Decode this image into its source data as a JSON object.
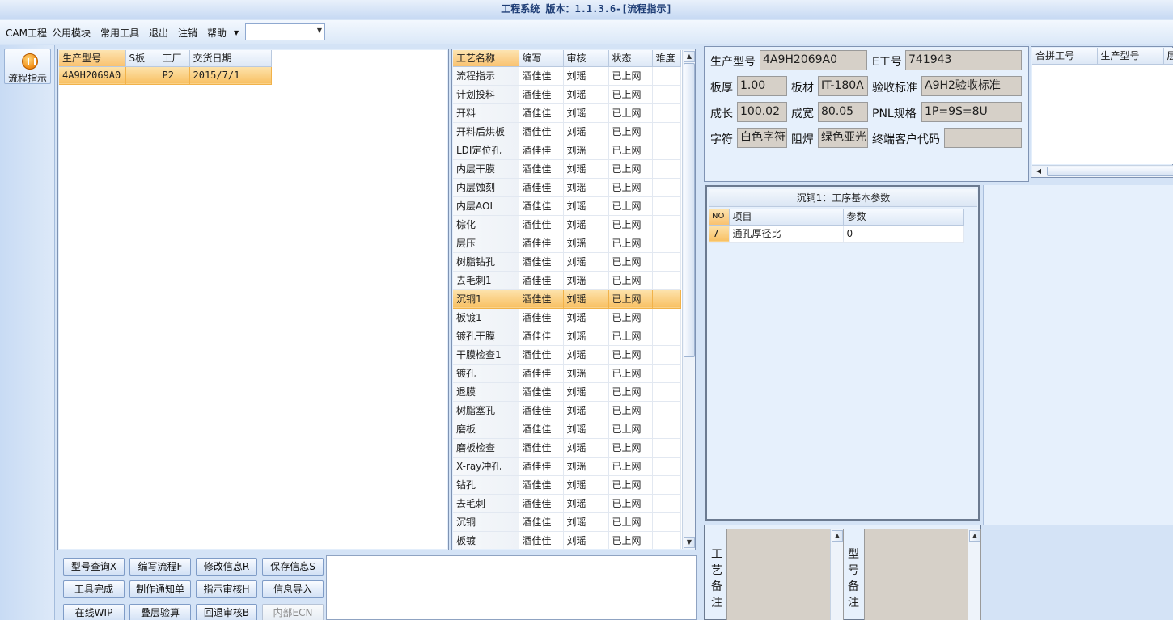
{
  "window": {
    "title": "工程系统 版本：1.1.3.6-[流程指示]"
  },
  "menu": {
    "items": [
      "CAM工程",
      "公用模块",
      "常用工具",
      "退出",
      "注销",
      "帮助"
    ],
    "combo_value": ""
  },
  "nav": {
    "button_label": "流程指示"
  },
  "order_grid": {
    "columns": [
      "生产型号",
      "S板",
      "工厂",
      "交货日期"
    ],
    "rows": [
      [
        "4A9H2069A0",
        "",
        "P2",
        "2015/7/1"
      ]
    ]
  },
  "process_grid": {
    "columns": [
      "工艺名称",
      "编写",
      "审核",
      "状态",
      "难度"
    ],
    "selected_index": 12,
    "rows": [
      [
        "流程指示",
        "酒佳佳",
        "刘瑶",
        "已上网",
        ""
      ],
      [
        "计划投料",
        "酒佳佳",
        "刘瑶",
        "已上网",
        ""
      ],
      [
        "开料",
        "酒佳佳",
        "刘瑶",
        "已上网",
        ""
      ],
      [
        "开料后烘板",
        "酒佳佳",
        "刘瑶",
        "已上网",
        ""
      ],
      [
        "LDI定位孔",
        "酒佳佳",
        "刘瑶",
        "已上网",
        ""
      ],
      [
        "内层干膜",
        "酒佳佳",
        "刘瑶",
        "已上网",
        ""
      ],
      [
        "内层蚀刻",
        "酒佳佳",
        "刘瑶",
        "已上网",
        ""
      ],
      [
        "内层AOI",
        "酒佳佳",
        "刘瑶",
        "已上网",
        ""
      ],
      [
        "棕化",
        "酒佳佳",
        "刘瑶",
        "已上网",
        ""
      ],
      [
        "层压",
        "酒佳佳",
        "刘瑶",
        "已上网",
        ""
      ],
      [
        "树脂钻孔",
        "酒佳佳",
        "刘瑶",
        "已上网",
        ""
      ],
      [
        "去毛刺1",
        "酒佳佳",
        "刘瑶",
        "已上网",
        ""
      ],
      [
        "沉铜1",
        "酒佳佳",
        "刘瑶",
        "已上网",
        ""
      ],
      [
        "板镀1",
        "酒佳佳",
        "刘瑶",
        "已上网",
        ""
      ],
      [
        "镀孔干膜",
        "酒佳佳",
        "刘瑶",
        "已上网",
        ""
      ],
      [
        "干膜检查1",
        "酒佳佳",
        "刘瑶",
        "已上网",
        ""
      ],
      [
        "镀孔",
        "酒佳佳",
        "刘瑶",
        "已上网",
        ""
      ],
      [
        "退膜",
        "酒佳佳",
        "刘瑶",
        "已上网",
        ""
      ],
      [
        "树脂塞孔",
        "酒佳佳",
        "刘瑶",
        "已上网",
        ""
      ],
      [
        "磨板",
        "酒佳佳",
        "刘瑶",
        "已上网",
        ""
      ],
      [
        "磨板检查",
        "酒佳佳",
        "刘瑶",
        "已上网",
        ""
      ],
      [
        "X-ray冲孔",
        "酒佳佳",
        "刘瑶",
        "已上网",
        ""
      ],
      [
        "钻孔",
        "酒佳佳",
        "刘瑶",
        "已上网",
        ""
      ],
      [
        "去毛刺",
        "酒佳佳",
        "刘瑶",
        "已上网",
        ""
      ],
      [
        "沉铜",
        "酒佳佳",
        "刘瑶",
        "已上网",
        ""
      ],
      [
        "板镀",
        "酒佳佳",
        "刘瑶",
        "已上网",
        ""
      ]
    ]
  },
  "buttons": {
    "row1": [
      "型号查询X",
      "编写流程F",
      "修改信息R",
      "保存信息S"
    ],
    "row2": [
      "工具完成",
      "制作通知单",
      "指示审核H",
      "信息导入"
    ],
    "row3": [
      "在线WIP",
      "叠层验算",
      "回退审核B",
      "内部ECN"
    ]
  },
  "info": {
    "part_no_label": "生产型号",
    "part_no": "4A9H2069A0",
    "e_no_label": "E工号",
    "e_no": "741943",
    "thickness_label": "板厚",
    "thickness": "1.00",
    "material_label": "板材",
    "material": "IT-180A",
    "accept_label": "验收标准",
    "accept": "A9H2验收标准",
    "length_label": "成长",
    "length": "100.02",
    "width_label": "成宽",
    "width": "80.05",
    "pnl_label": "PNL规格",
    "pnl": "1P=9S=8U",
    "char_label": "字符",
    "char": "白色字符",
    "mask_label": "阻焊",
    "mask": "绿色亚光",
    "end_customer_label": "终端客户代码",
    "end_customer": ""
  },
  "merge_grid": {
    "columns": [
      "合拼工号",
      "生产型号",
      "层"
    ]
  },
  "params": {
    "title": "沉铜1：工序基本参数",
    "columns": [
      "NO",
      "项目",
      "参数"
    ],
    "rows": [
      [
        "7",
        "通孔厚径比",
        "0"
      ]
    ]
  },
  "remarks": {
    "process_label": "工艺备注",
    "model_label": "型号备注"
  }
}
